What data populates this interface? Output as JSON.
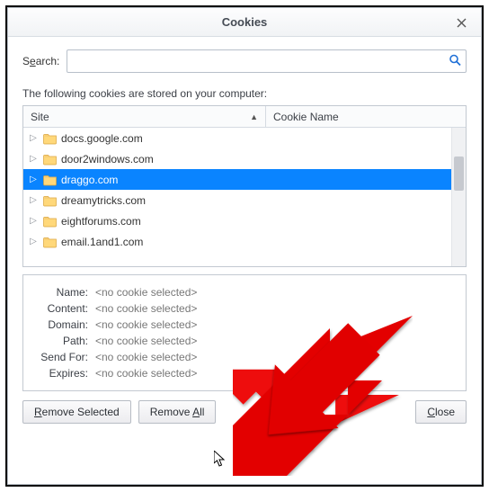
{
  "title": "Cookies",
  "search": {
    "label_pre": "S",
    "label_ul": "e",
    "label_post": "arch:",
    "placeholder": "",
    "value": ""
  },
  "hint": "The following cookies are stored on your computer:",
  "columns": {
    "site": "Site",
    "cookie_name": "Cookie Name"
  },
  "sites": [
    {
      "name": "docs.google.com",
      "sel": false
    },
    {
      "name": "door2windows.com",
      "sel": false
    },
    {
      "name": "draggo.com",
      "sel": true
    },
    {
      "name": "dreamytricks.com",
      "sel": false
    },
    {
      "name": "eightforums.com",
      "sel": false
    },
    {
      "name": "email.1and1.com",
      "sel": false
    }
  ],
  "detail": {
    "labels": {
      "name": "Name:",
      "content": "Content:",
      "domain": "Domain:",
      "path": "Path:",
      "sendfor": "Send For:",
      "expires": "Expires:"
    },
    "value": "<no cookie selected>"
  },
  "buttons": {
    "remove_selected_pre": "",
    "remove_selected_ul": "R",
    "remove_selected_post": "emove Selected",
    "remove_all_pre": "Remove ",
    "remove_all_ul": "A",
    "remove_all_post": "ll",
    "close_pre": "",
    "close_ul": "C",
    "close_post": "lose"
  }
}
